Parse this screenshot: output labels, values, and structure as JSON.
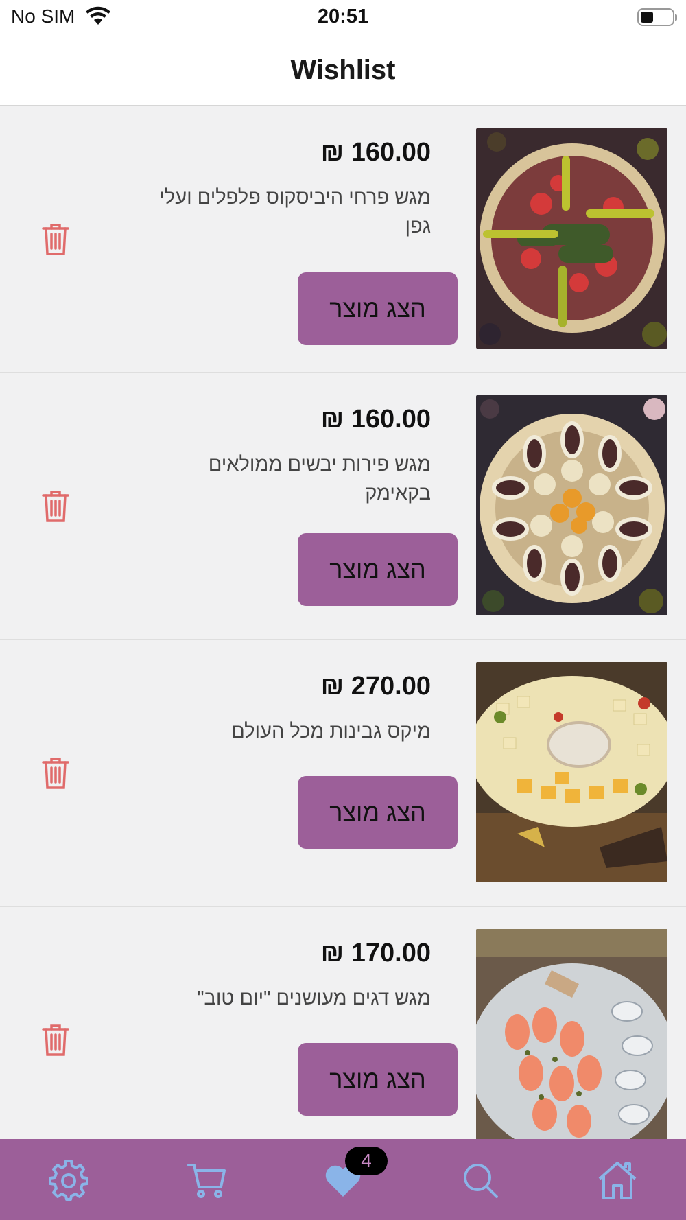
{
  "status_bar": {
    "carrier": "No SIM",
    "time": "20:51"
  },
  "header": {
    "title": "Wishlist"
  },
  "items": [
    {
      "price": "₪ 160.00",
      "name": "מגש פרחי היביסקוס פלפלים ועלי גפן",
      "button_label": "הצג מוצר"
    },
    {
      "price": "₪ 160.00",
      "name": "מגש פירות יבשים ממולאים בקאימק",
      "button_label": "הצג מוצר"
    },
    {
      "price": "₪ 270.00",
      "name": "מיקס גבינות מכל העולם",
      "button_label": "הצג מוצר"
    },
    {
      "price": "₪ 170.00",
      "name": "מגש דגים מעושנים \"יום טוב\"",
      "button_label": "הצג מוצר"
    }
  ],
  "tabbar": {
    "wishlist_count": "4",
    "icons": [
      "gear-icon",
      "cart-icon",
      "heart-icon",
      "search-icon",
      "home-icon"
    ]
  },
  "colors": {
    "accent": "#9c5f99",
    "tab_icon": "#8ab4e8",
    "trash": "#e06b6b"
  }
}
